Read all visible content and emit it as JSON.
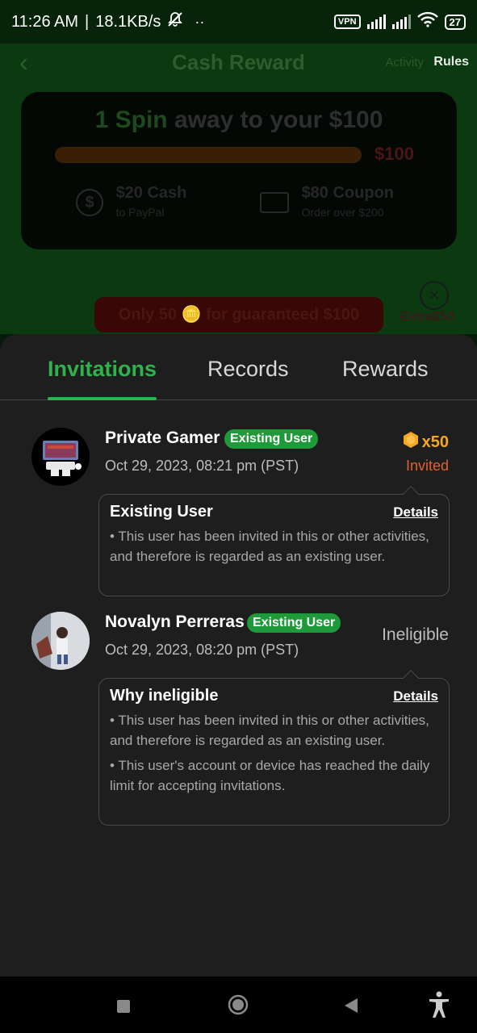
{
  "status_bar": {
    "time": "11:26 AM",
    "speed": "18.1KB/s",
    "vpn": "VPN",
    "battery": "27"
  },
  "background": {
    "title": "Cash Reward",
    "activity_link": "Activity",
    "rules_link": "Rules",
    "headline_highlight": "1 Spin",
    "headline_rest": " away to your $100",
    "progress_amount": "$100",
    "option1_title": "$20 Cash",
    "option1_sub": "to PayPal",
    "option2_title": "$80 Coupon",
    "option2_sub": "Order over $200",
    "promo": "Only 50 🪙 for guaranteed $100",
    "extra_label": "Extra$50"
  },
  "tabs": [
    {
      "label": "Invitations",
      "active": true
    },
    {
      "label": "Records",
      "active": false
    },
    {
      "label": "Rewards",
      "active": false
    }
  ],
  "entries": [
    {
      "name": "Private Gamer",
      "badge": "Existing User",
      "date": "Oct 29, 2023, 08:21 pm (PST)",
      "reward_amount": "x50",
      "status": "Invited",
      "box_title": "Existing User",
      "details_label": "Details",
      "points": [
        "This user has been invited in this or other activities, and therefore is regarded as an existing user."
      ]
    },
    {
      "name": "Novalyn Perreras",
      "badge": "Existing User",
      "date": "Oct 29, 2023, 08:20 pm (PST)",
      "status": "Ineligible",
      "box_title": "Why ineligible",
      "details_label": "Details",
      "points": [
        "This user has been invited in this or other activities, and therefore is regarded as an existing user.",
        "This user's account or device has reached the daily limit for accepting invitations."
      ]
    }
  ],
  "colors": {
    "accent": "#30b14c",
    "badge": "#1f9a3a",
    "coin": "#f5a623",
    "invited": "#e0622e"
  }
}
